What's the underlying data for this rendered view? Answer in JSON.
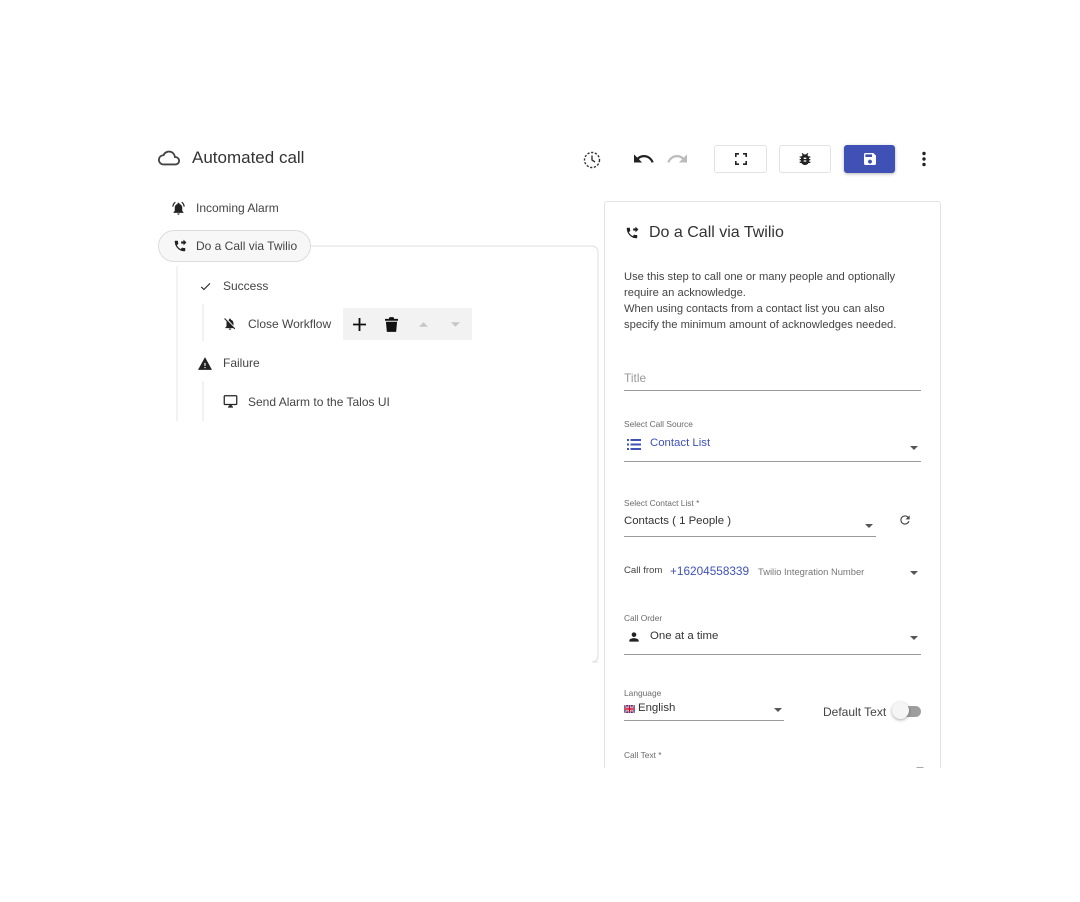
{
  "header": {
    "title": "Automated call"
  },
  "toolbar": {
    "history_icon": "history-clock-icon",
    "undo_icon": "undo-icon",
    "redo_icon": "redo-icon",
    "fullscreen_icon": "fullscreen-icon",
    "debug_icon": "bug-icon",
    "save_icon": "save-icon",
    "more_icon": "more-vertical-icon",
    "primary_color": "#3f51b5"
  },
  "tree": {
    "trigger": {
      "label": "Incoming Alarm",
      "icon": "alarm-bell-icon"
    },
    "step": {
      "label": "Do a Call via Twilio",
      "icon": "phone-forward-icon"
    },
    "success": {
      "label": "Success",
      "icon": "check-icon"
    },
    "close_workflow": {
      "label": "Close Workflow",
      "icon": "bell-off-icon"
    },
    "failure": {
      "label": "Failure",
      "icon": "warning-icon"
    },
    "send_alarm": {
      "label": "Send Alarm to the Talos UI",
      "icon": "monitor-icon"
    }
  },
  "panel": {
    "title": "Do a Call via Twilio",
    "desc_line1": "Use this step to call one or many people and optionally",
    "desc_line2": "require an acknowledge.",
    "desc_line3": "When using contacts from a contact list you can also",
    "desc_line4": "specify the minimum amount of acknowledges needed.",
    "title_placeholder": "Title",
    "call_source_label": "Select Call Source",
    "call_source_value": "Contact List",
    "contact_list_label": "Select Contact List *",
    "contact_list_value": "Contacts ( 1 People )",
    "call_from_label": "Call from",
    "call_from_number": "+16204558339",
    "call_from_desc": "Twilio Integration Number",
    "call_order_label": "Call Order",
    "call_order_value": "One at a time",
    "language_label": "Language",
    "language_value": "English",
    "default_text_label": "Default Text",
    "default_text_on": false,
    "call_text_label": "Call Text *",
    "link_color": "#3f51b5"
  }
}
